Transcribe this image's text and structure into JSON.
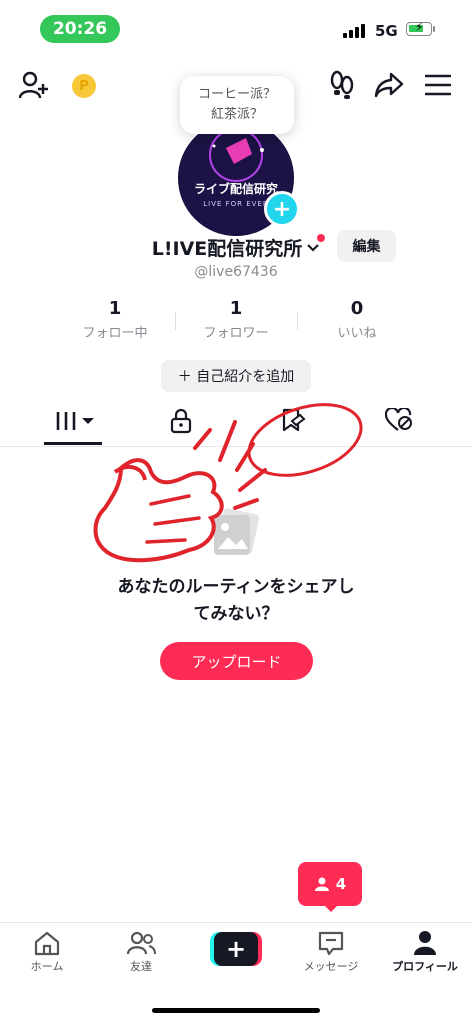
{
  "status_bar": {
    "time": "20:26",
    "network": "5G"
  },
  "profile": {
    "bubble_line1": "コーヒー派？",
    "bubble_line2": "紅茶派？",
    "avatar_text": "ライブ配信研究",
    "avatar_subtext": "LIVE FOR EVER",
    "display_name": "L!IVE配信研究所",
    "edit_label": "編集",
    "handle": "@live67436"
  },
  "stats": [
    {
      "value": "1",
      "label": "フォロー中"
    },
    {
      "value": "1",
      "label": "フォロワー"
    },
    {
      "value": "0",
      "label": "いいね"
    }
  ],
  "bio_button": "＋ 自己紹介を追加",
  "empty_state": {
    "line1": "あなたのルーティンをシェアし",
    "line2": "てみない？",
    "upload_label": "アップロード"
  },
  "notification": {
    "count": "4"
  },
  "bottom_nav": [
    {
      "label": "ホーム"
    },
    {
      "label": "友達"
    },
    {
      "label": "メッセージ"
    },
    {
      "label": "プロフィール"
    }
  ],
  "colors": {
    "accent": "#fe2c55",
    "cyan": "#25f4ee",
    "annotation": "#e0242b"
  },
  "icons": [
    "add-friend-icon",
    "coin-icon",
    "footprint-icon",
    "share-icon",
    "menu-icon",
    "grid-icon",
    "lock-icon",
    "repost-icon",
    "liked-icon",
    "home-icon",
    "friends-icon",
    "create-icon",
    "message-icon",
    "profile-icon"
  ]
}
